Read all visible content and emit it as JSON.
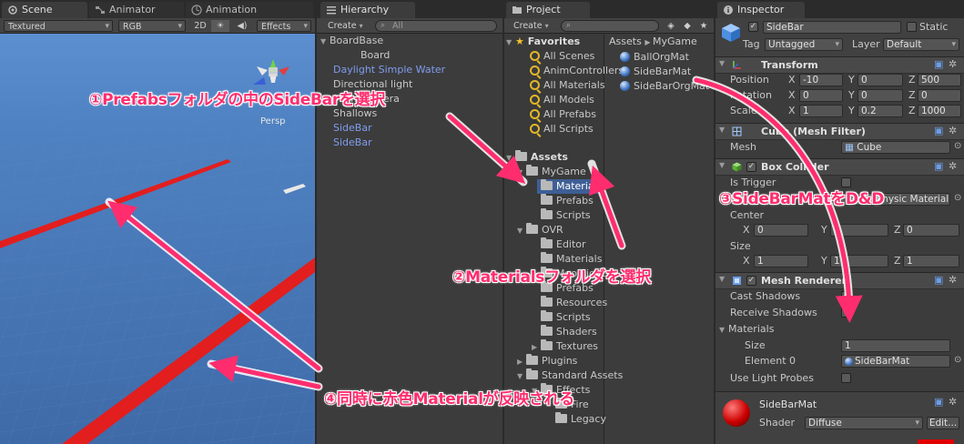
{
  "scene": {
    "tabs": [
      {
        "label": "Scene",
        "icon": "scene-icon"
      },
      {
        "label": "Animator",
        "icon": "animator-icon"
      },
      {
        "label": "Animation",
        "icon": "animation-icon"
      }
    ],
    "shading_mode": "Textured",
    "render_mode": "RGB",
    "mode_2d": "2D",
    "effects_label": "Effects",
    "gizmo_label": "Persp",
    "colors": {
      "sky": "#5b8fd0",
      "water": "#4a77b3",
      "bar": "#e21e1e"
    }
  },
  "hierarchy": {
    "tab_label": "Hierarchy",
    "create_label": "Create",
    "search_placeholder": "All",
    "items": [
      {
        "label": "BoardBase",
        "prefab": false,
        "indent": 0,
        "expanded": true
      },
      {
        "label": "Board",
        "prefab": false,
        "indent": 1
      },
      {
        "label": "Daylight Simple Water",
        "prefab": true,
        "indent": 0
      },
      {
        "label": "Directional light",
        "prefab": false,
        "indent": 0
      },
      {
        "label": "Main Camera",
        "prefab": false,
        "indent": 0
      },
      {
        "label": "Shallows",
        "prefab": false,
        "indent": 0
      },
      {
        "label": "SideBar",
        "prefab": true,
        "indent": 0
      },
      {
        "label": "SideBar",
        "prefab": true,
        "indent": 0
      }
    ]
  },
  "project": {
    "tab_label": "Project",
    "create_label": "Create",
    "favorites_label": "Favorites",
    "favorites": [
      "All Scenes",
      "AnimControllers",
      "All Materials",
      "All Models",
      "All Prefabs",
      "All Scripts"
    ],
    "assets_label": "Assets",
    "tree": [
      {
        "label": "MyGame",
        "indent": 1,
        "expanded": true
      },
      {
        "label": "Materials",
        "indent": 2,
        "selected": true
      },
      {
        "label": "Prefabs",
        "indent": 2
      },
      {
        "label": "Scripts",
        "indent": 2
      },
      {
        "label": "OVR",
        "indent": 1,
        "expanded": true
      },
      {
        "label": "Editor",
        "indent": 2
      },
      {
        "label": "Materials",
        "indent": 2
      },
      {
        "label": "Moonlight",
        "indent": 2
      },
      {
        "label": "Prefabs",
        "indent": 2
      },
      {
        "label": "Resources",
        "indent": 2
      },
      {
        "label": "Scripts",
        "indent": 2
      },
      {
        "label": "Shaders",
        "indent": 2
      },
      {
        "label": "Textures",
        "indent": 2,
        "collapsed": true
      },
      {
        "label": "Plugins",
        "indent": 1,
        "collapsed": true
      },
      {
        "label": "Standard Assets",
        "indent": 1,
        "expanded": true
      },
      {
        "label": "Effects",
        "indent": 2
      },
      {
        "label": "Fire",
        "indent": 3
      },
      {
        "label": "Legacy",
        "indent": 3
      }
    ],
    "breadcrumb": [
      "Assets",
      "MyGame"
    ],
    "files": [
      "BallOrgMat",
      "SideBarMat",
      "SideBarOrgMat"
    ]
  },
  "inspector": {
    "tab_label": "Inspector",
    "object_name": "SideBar",
    "static_label": "Static",
    "tag_label": "Tag",
    "tag_value": "Untagged",
    "layer_label": "Layer",
    "layer_value": "Default",
    "transform": {
      "title": "Transform",
      "position_label": "Position",
      "rotation_label": "Rotation",
      "scale_label": "Scale",
      "position": {
        "x": "-10",
        "y": "0",
        "z": "500"
      },
      "rotation": {
        "x": "0",
        "y": "0",
        "z": "0"
      },
      "scale": {
        "x": "1",
        "y": "0.2",
        "z": "1000"
      }
    },
    "mesh_filter": {
      "title": "Cube (Mesh Filter)",
      "mesh_label": "Mesh",
      "mesh_value": "Cube"
    },
    "box_collider": {
      "title": "Box Collider",
      "trigger_label": "Is Trigger",
      "material_label": "Material",
      "material_value": "None (Physic Material)",
      "center_label": "Center",
      "center": {
        "x": "0",
        "y": "0",
        "z": "0"
      },
      "size_label": "Size",
      "size": {
        "x": "1",
        "y": "1",
        "z": "1"
      }
    },
    "mesh_renderer": {
      "title": "Mesh Renderer",
      "cast_shadows_label": "Cast Shadows",
      "receive_shadows_label": "Receive Shadows",
      "materials_label": "Materials",
      "size_label": "Size",
      "size_value": "1",
      "element_label": "Element 0",
      "element_value": "SideBarMat",
      "light_probes_label": "Use Light Probes"
    },
    "material": {
      "name": "SideBarMat",
      "shader_label": "Shader",
      "shader_value": "Diffuse",
      "edit_label": "Edit..."
    },
    "axis_labels": {
      "x": "X",
      "y": "Y",
      "z": "Z"
    },
    "colors": {
      "material_swatch": "#e00000"
    }
  },
  "annotations": [
    {
      "text": "①Prefabsフォルダの中のSideBarを選択"
    },
    {
      "text": "②Materialsフォルダを選択"
    },
    {
      "text": "③SideBarMatをD&D"
    },
    {
      "text": "④同時に赤色Materialが反映される"
    }
  ],
  "annotation_color": "#ff2d6e"
}
